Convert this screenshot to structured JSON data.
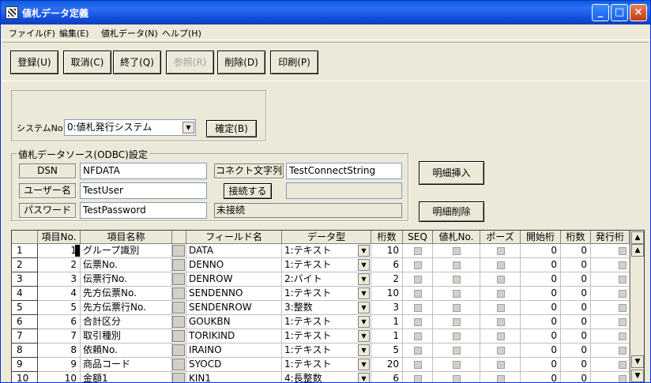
{
  "window": {
    "title": "値札データ定義",
    "minimize": "_",
    "maximize": "□",
    "close": "×"
  },
  "menu": [
    "ファイル(F)",
    "編集(E)",
    "値札データ(N)",
    "ヘルプ(H)"
  ],
  "toolbar": {
    "register": "登録(U)",
    "cancel": "取消(C)",
    "exit": "終了(Q)",
    "reference": "参照(R)",
    "delete": "削除(D)",
    "print": "印刷(P)"
  },
  "system": {
    "label": "システムNo",
    "value": "0:値札発行システム",
    "confirm": "確定(B)"
  },
  "odbc": {
    "group_label": "値札データソース(ODBC)設定",
    "dsn_label": "DSN",
    "dsn_value": "NFDATA",
    "user_label": "ユーザー名",
    "user_value": "TestUser",
    "pass_label": "パスワード",
    "pass_value": "TestPassword",
    "conn_label": "コネクト文字列",
    "conn_value": "TestConnectString",
    "connect_button": "接続する",
    "status": "未接続"
  },
  "buttons": {
    "insert_row": "明細挿入",
    "delete_row": "明細削除"
  },
  "grid": {
    "headers": [
      "項目No.",
      "項目名称",
      "フィールド名",
      "データ型",
      "桁数",
      "SEQ",
      "値札No.",
      "ポーズ",
      "開始桁",
      "桁数",
      "発行桁"
    ],
    "rows": [
      {
        "n": "1",
        "no": "1",
        "name": "グループ識別",
        "field": "DATA",
        "type": "1:テキスト",
        "digits": "10",
        "start": "0",
        "len": "0"
      },
      {
        "n": "2",
        "no": "2",
        "name": "伝票No.",
        "field": "DENNO",
        "type": "1:テキスト",
        "digits": "6",
        "start": "0",
        "len": "0"
      },
      {
        "n": "3",
        "no": "3",
        "name": "伝票行No.",
        "field": "DENROW",
        "type": "2:バイト",
        "digits": "2",
        "start": "0",
        "len": "0"
      },
      {
        "n": "4",
        "no": "4",
        "name": "先方伝票No.",
        "field": "SENDENNO",
        "type": "1:テキスト",
        "digits": "10",
        "start": "0",
        "len": "0"
      },
      {
        "n": "5",
        "no": "5",
        "name": "先方伝票行No.",
        "field": "SENDENROW",
        "type": "3:整数",
        "digits": "3",
        "start": "0",
        "len": "0"
      },
      {
        "n": "6",
        "no": "6",
        "name": "合計区分",
        "field": "GOUKBN",
        "type": "1:テキスト",
        "digits": "1",
        "start": "0",
        "len": "0"
      },
      {
        "n": "7",
        "no": "7",
        "name": "取引種別",
        "field": "TORIKIND",
        "type": "1:テキスト",
        "digits": "1",
        "start": "0",
        "len": "0"
      },
      {
        "n": "8",
        "no": "8",
        "name": "依頼No.",
        "field": "IRAINO",
        "type": "1:テキスト",
        "digits": "5",
        "start": "0",
        "len": "0"
      },
      {
        "n": "9",
        "no": "9",
        "name": "商品コード",
        "field": "SYOCD",
        "type": "1:テキスト",
        "digits": "20",
        "start": "0",
        "len": "0"
      },
      {
        "n": "10",
        "no": "10",
        "name": "金額1",
        "field": "KIN1",
        "type": "4:長整数",
        "digits": "6",
        "start": "0",
        "len": "0"
      }
    ]
  }
}
